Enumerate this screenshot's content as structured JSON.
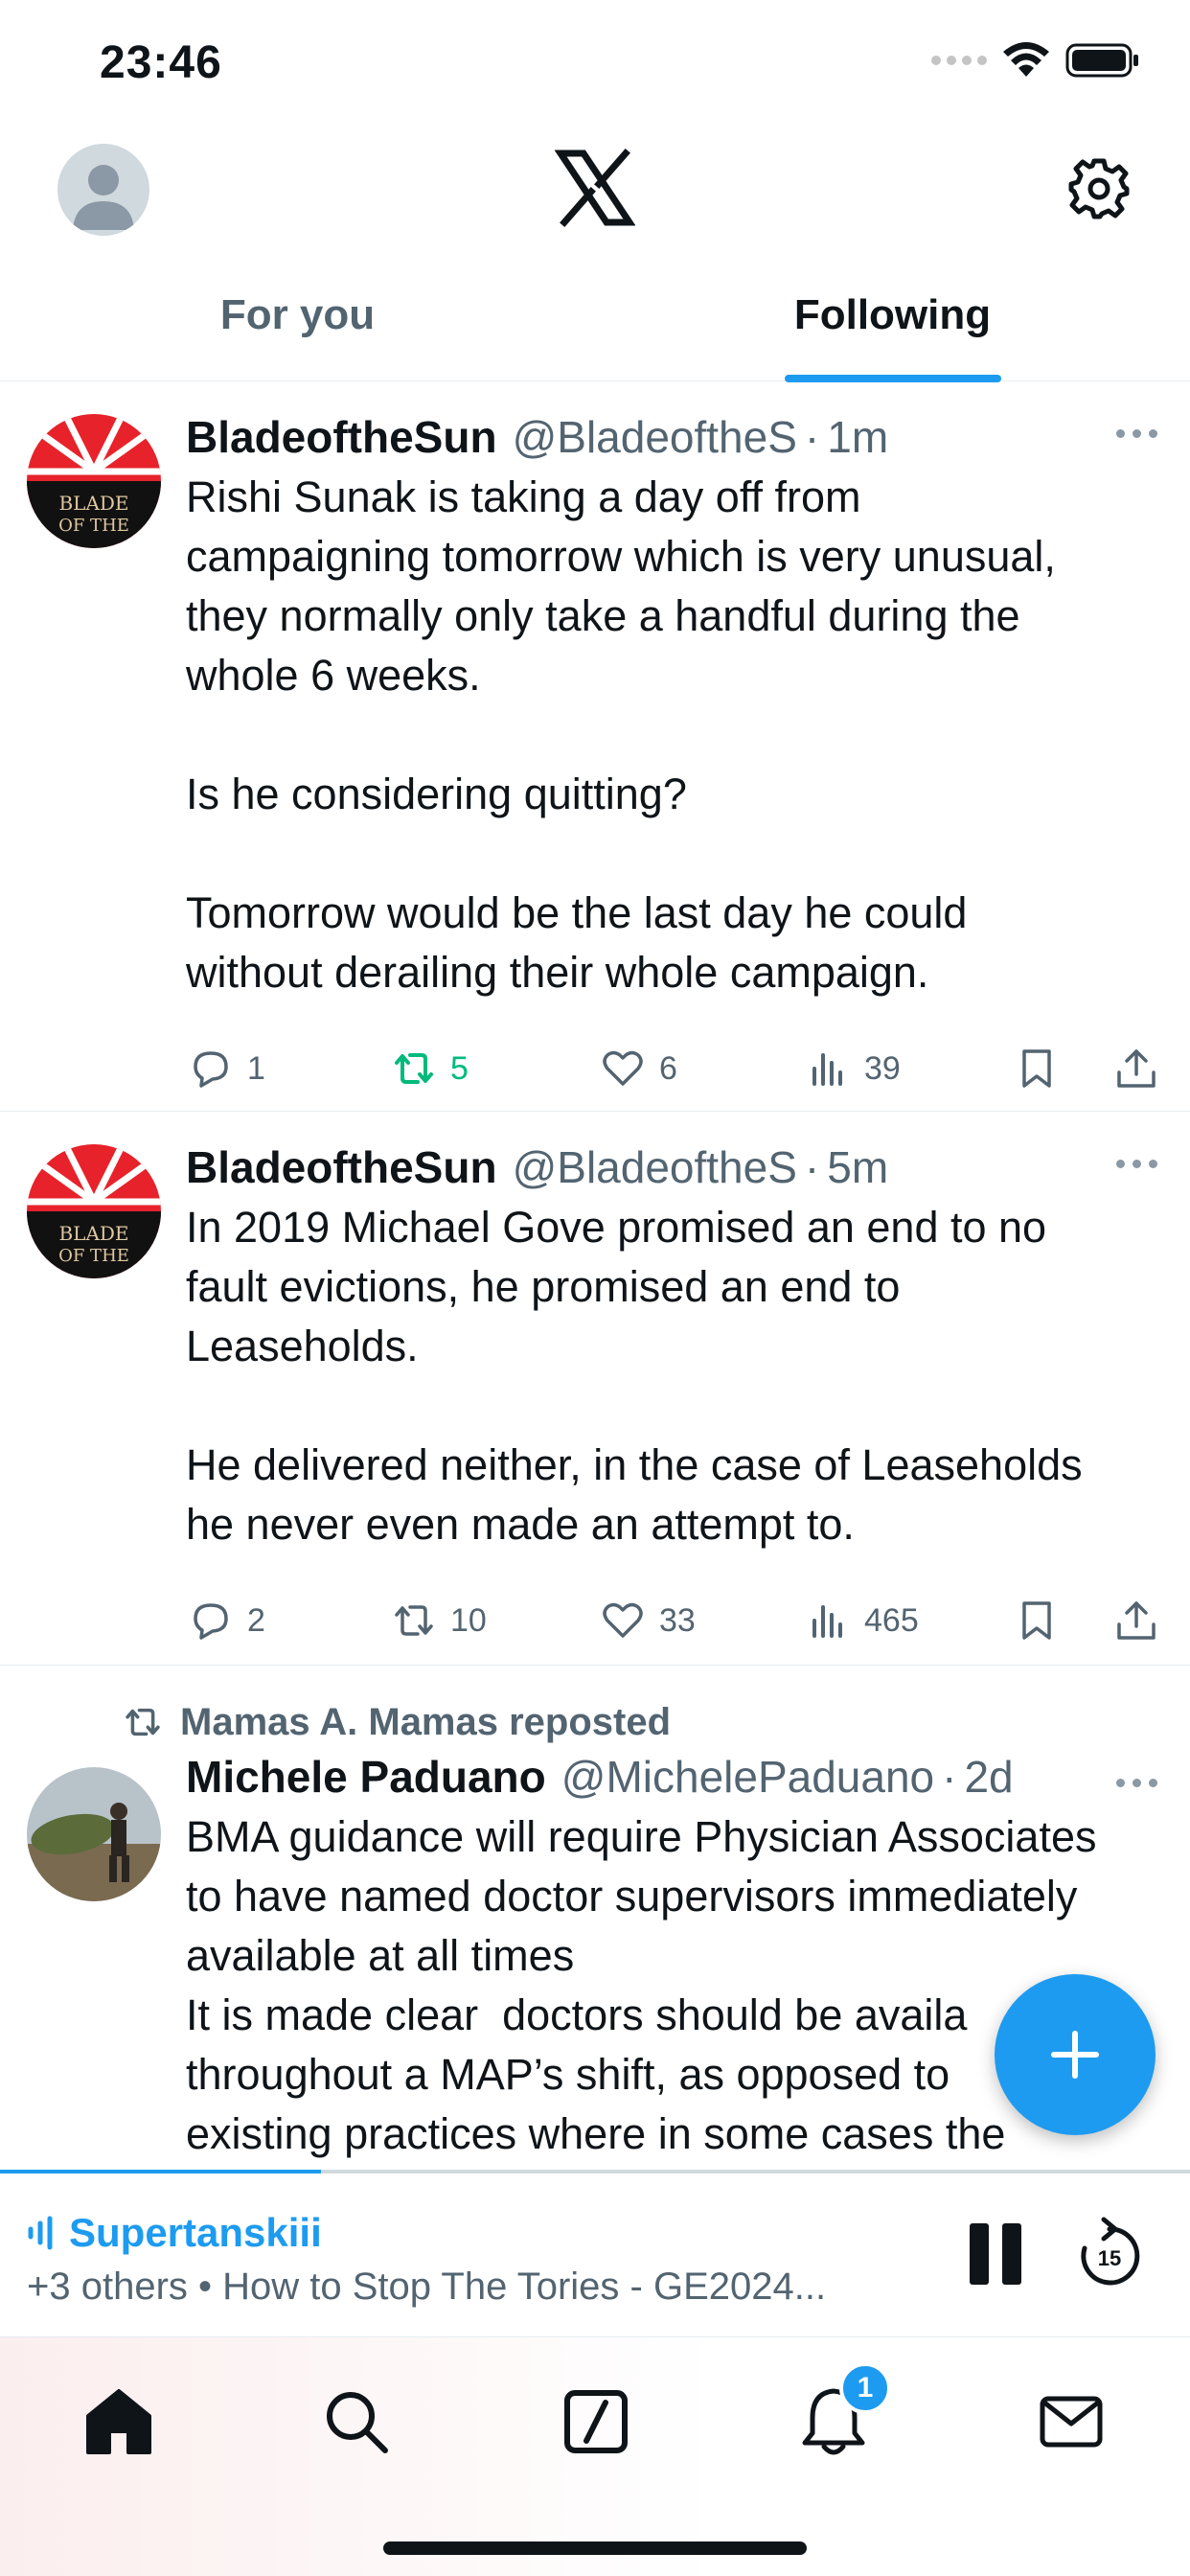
{
  "status_bar": {
    "time": "23:46"
  },
  "header": {
    "logo": "x-logo",
    "settings_icon": "gear-icon"
  },
  "tabs": [
    {
      "label": "For you",
      "active": false
    },
    {
      "label": "Following",
      "active": true
    }
  ],
  "tweets": [
    {
      "name": "BladeoftheSun",
      "handle": "@BladeoftheS",
      "time": "1m",
      "text": "Rishi Sunak is taking a day off from\ncampaigning tomorrow which is very unusual,\nthey normally only take a handful during the\nwhole 6 weeks.\n\nIs he considering quitting?\n\nTomorrow would be the last day he could\nwithout derailing their whole campaign.",
      "replies": "1",
      "reposts": "5",
      "reposted_by_me": true,
      "likes": "6",
      "views": "39"
    },
    {
      "name": "BladeoftheSun",
      "handle": "@BladeoftheS",
      "time": "5m",
      "text": "In 2019 Michael Gove promised an end to no\nfault evictions, he promised an end to\nLeaseholds.\n\nHe delivered neither, in the case of Leaseholds\nhe never even made an attempt to.",
      "replies": "2",
      "reposts": "10",
      "reposted_by_me": false,
      "likes": "33",
      "views": "465"
    },
    {
      "reposted_by": "Mamas A. Mamas reposted",
      "name": "Michele Paduano",
      "handle": "@MichelePaduano",
      "time": "2d",
      "text": "BMA guidance will require Physician Associates\nto have named doctor supervisors immediately\navailable at all times\nIt is made clear  doctors should be availa\nthroughout a MAP’s shift, as opposed to\nexisting practices where in some cases the"
    }
  ],
  "separator": "·",
  "audio": {
    "host": "Supertanskiii",
    "subtitle": "+3 others • How to Stop The Tories - GE2024...",
    "replay_seconds": "15",
    "progress": 0.27
  },
  "nav": {
    "items": [
      "home-icon",
      "search-icon",
      "grok-icon",
      "bell-icon",
      "mail-icon"
    ],
    "notifications_badge": "1"
  },
  "colors": {
    "accent": "#1d9bf0",
    "repost_green": "#00ba7c",
    "text": "#0f1419",
    "muted": "#536471"
  }
}
